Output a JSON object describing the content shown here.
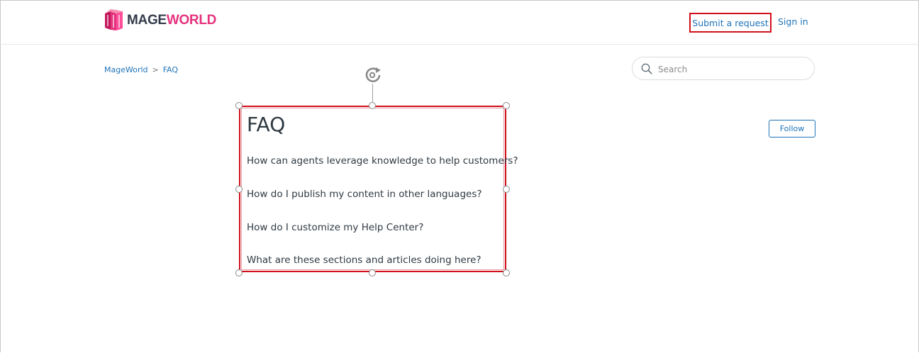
{
  "header": {
    "logo_text_part1": "MAGE",
    "logo_text_part2": "WORLD",
    "submit_request_label": "Submit a request",
    "sign_in_label": "Sign in"
  },
  "breadcrumb": {
    "items": [
      "MageWorld",
      "FAQ"
    ],
    "separator": ">"
  },
  "search": {
    "placeholder": "Search",
    "value": ""
  },
  "section": {
    "title": "FAQ",
    "follow_label": "Follow",
    "articles": [
      "How can agents leverage knowledge to help customers?",
      "How do I publish my content in other languages?",
      "How do I customize my Help Center?",
      "What are these sections and articles doing here?"
    ]
  },
  "colors": {
    "link": "#1f73b7",
    "highlight_border": "#d0101c",
    "brand_pink": "#e5337e",
    "brand_dark": "#333b4a"
  },
  "icons": [
    "mageworld-logo-icon",
    "search-icon",
    "rotate-icon"
  ]
}
